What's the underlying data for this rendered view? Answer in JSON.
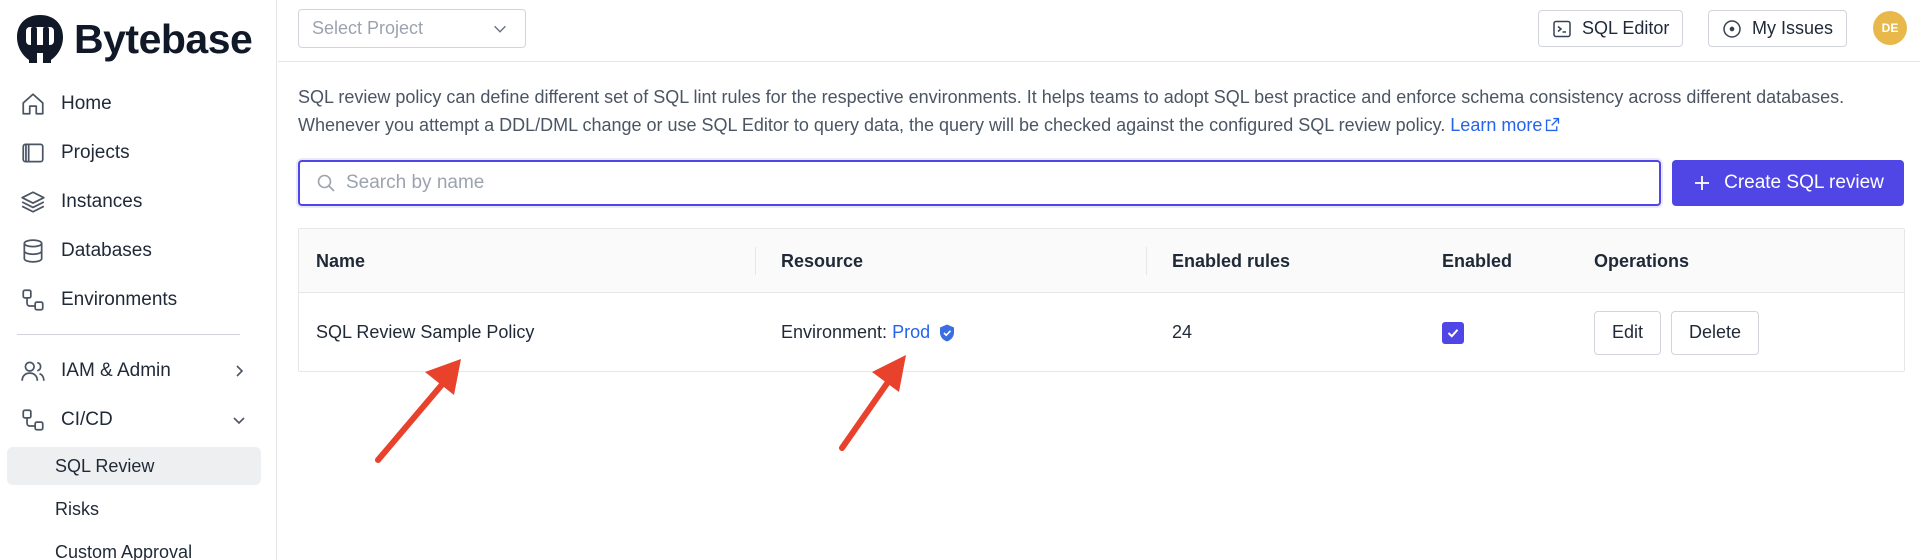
{
  "brand": {
    "name": "Bytebase"
  },
  "sidebar": {
    "items": [
      {
        "label": "Home",
        "icon": "home-icon"
      },
      {
        "label": "Projects",
        "icon": "projects-icon"
      },
      {
        "label": "Instances",
        "icon": "layers-icon"
      },
      {
        "label": "Databases",
        "icon": "database-icon"
      },
      {
        "label": "Environments",
        "icon": "environments-icon"
      },
      {
        "label": "IAM & Admin",
        "icon": "users-icon",
        "expanded": false
      },
      {
        "label": "CI/CD",
        "icon": "workflow-icon",
        "expanded": true
      }
    ],
    "subitems": [
      {
        "label": "SQL Review",
        "active": true
      },
      {
        "label": "Risks",
        "active": false
      },
      {
        "label": "Custom Approval",
        "active": false
      }
    ]
  },
  "topbar": {
    "project_select_placeholder": "Select Project",
    "sql_editor_label": "SQL Editor",
    "my_issues_label": "My Issues",
    "avatar_initials": "DE"
  },
  "main": {
    "description": "SQL review policy can define different set of SQL lint rules for the respective environments. It helps teams to adopt SQL best practice and enforce schema consistency across different databases. Whenever you attempt a DDL/DML change or use SQL Editor to query data, the query will be checked against the configured SQL review policy.",
    "learn_more": "Learn more",
    "search_placeholder": "Search by name",
    "create_label": "Create SQL review",
    "table": {
      "headers": [
        "Name",
        "Resource",
        "Enabled rules",
        "Enabled",
        "Operations"
      ],
      "rows": [
        {
          "name": "SQL Review Sample Policy",
          "resource_prefix": "Environment:",
          "resource_link": "Prod",
          "enabled_rules": "24",
          "enabled": true,
          "edit_label": "Edit",
          "delete_label": "Delete"
        }
      ]
    }
  },
  "colors": {
    "primary": "#4f46e5",
    "link": "#2563eb",
    "annotation_arrow": "#e8412c",
    "avatar_bg": "#e8b94a"
  }
}
